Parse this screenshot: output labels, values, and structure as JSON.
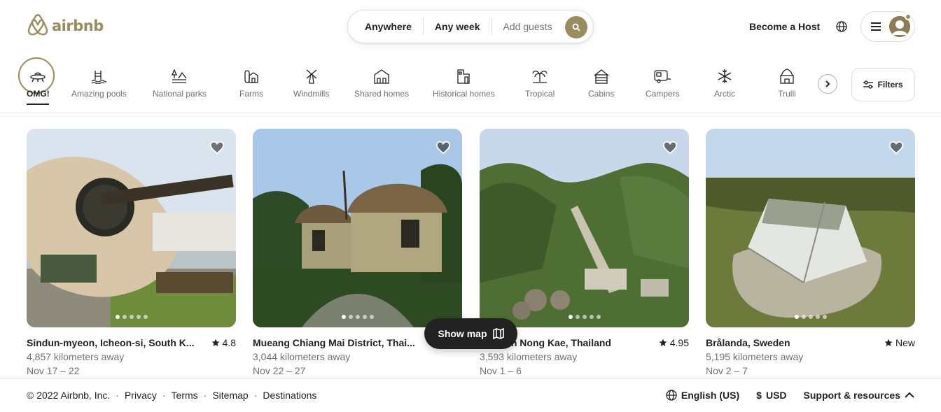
{
  "brand": {
    "name": "airbnb",
    "color": "#9a8c5e"
  },
  "search": {
    "anywhere": "Anywhere",
    "any_week": "Any week",
    "add_guests": "Add guests"
  },
  "header": {
    "become_host": "Become a Host"
  },
  "categories": [
    {
      "label": "OMG!",
      "icon": "ufo-icon",
      "active": true
    },
    {
      "label": "Amazing pools",
      "icon": "pool-icon"
    },
    {
      "label": "National parks",
      "icon": "park-icon"
    },
    {
      "label": "Farms",
      "icon": "farm-icon"
    },
    {
      "label": "Windmills",
      "icon": "windmill-icon"
    },
    {
      "label": "Shared homes",
      "icon": "shared-home-icon"
    },
    {
      "label": "Historical homes",
      "icon": "historical-home-icon"
    },
    {
      "label": "Tropical",
      "icon": "palm-tree-icon"
    },
    {
      "label": "Cabins",
      "icon": "cabin-icon"
    },
    {
      "label": "Campers",
      "icon": "camper-icon"
    },
    {
      "label": "Arctic",
      "icon": "snowflake-icon"
    },
    {
      "label": "Trulli",
      "icon": "trulli-icon"
    }
  ],
  "filters_label": "Filters",
  "listings": [
    {
      "title": "Sindun-myeon, Icheon-si, South K...",
      "rating": "4.8",
      "distance": "4,857 kilometers away",
      "dates": "Nov 17 – 22"
    },
    {
      "title": "Mueang Chiang Mai District, Thai...",
      "rating": "",
      "distance": "3,044 kilometers away",
      "dates": "Nov 22 – 27"
    },
    {
      "title": "Tambon Nong Kae, Thailand",
      "rating": "4.95",
      "distance": "3,593 kilometers away",
      "dates": "Nov 1 – 6"
    },
    {
      "title": "Brålanda, Sweden",
      "rating": "New",
      "distance": "5,195 kilometers away",
      "dates": "Nov 2 – 7"
    }
  ],
  "show_map": "Show map",
  "footer": {
    "copyright": "© 2022 Airbnb, Inc.",
    "links": [
      "Privacy",
      "Terms",
      "Sitemap",
      "Destinations"
    ],
    "language": "English (US)",
    "currency_symbol": "$",
    "currency": "USD",
    "support": "Support & resources"
  }
}
